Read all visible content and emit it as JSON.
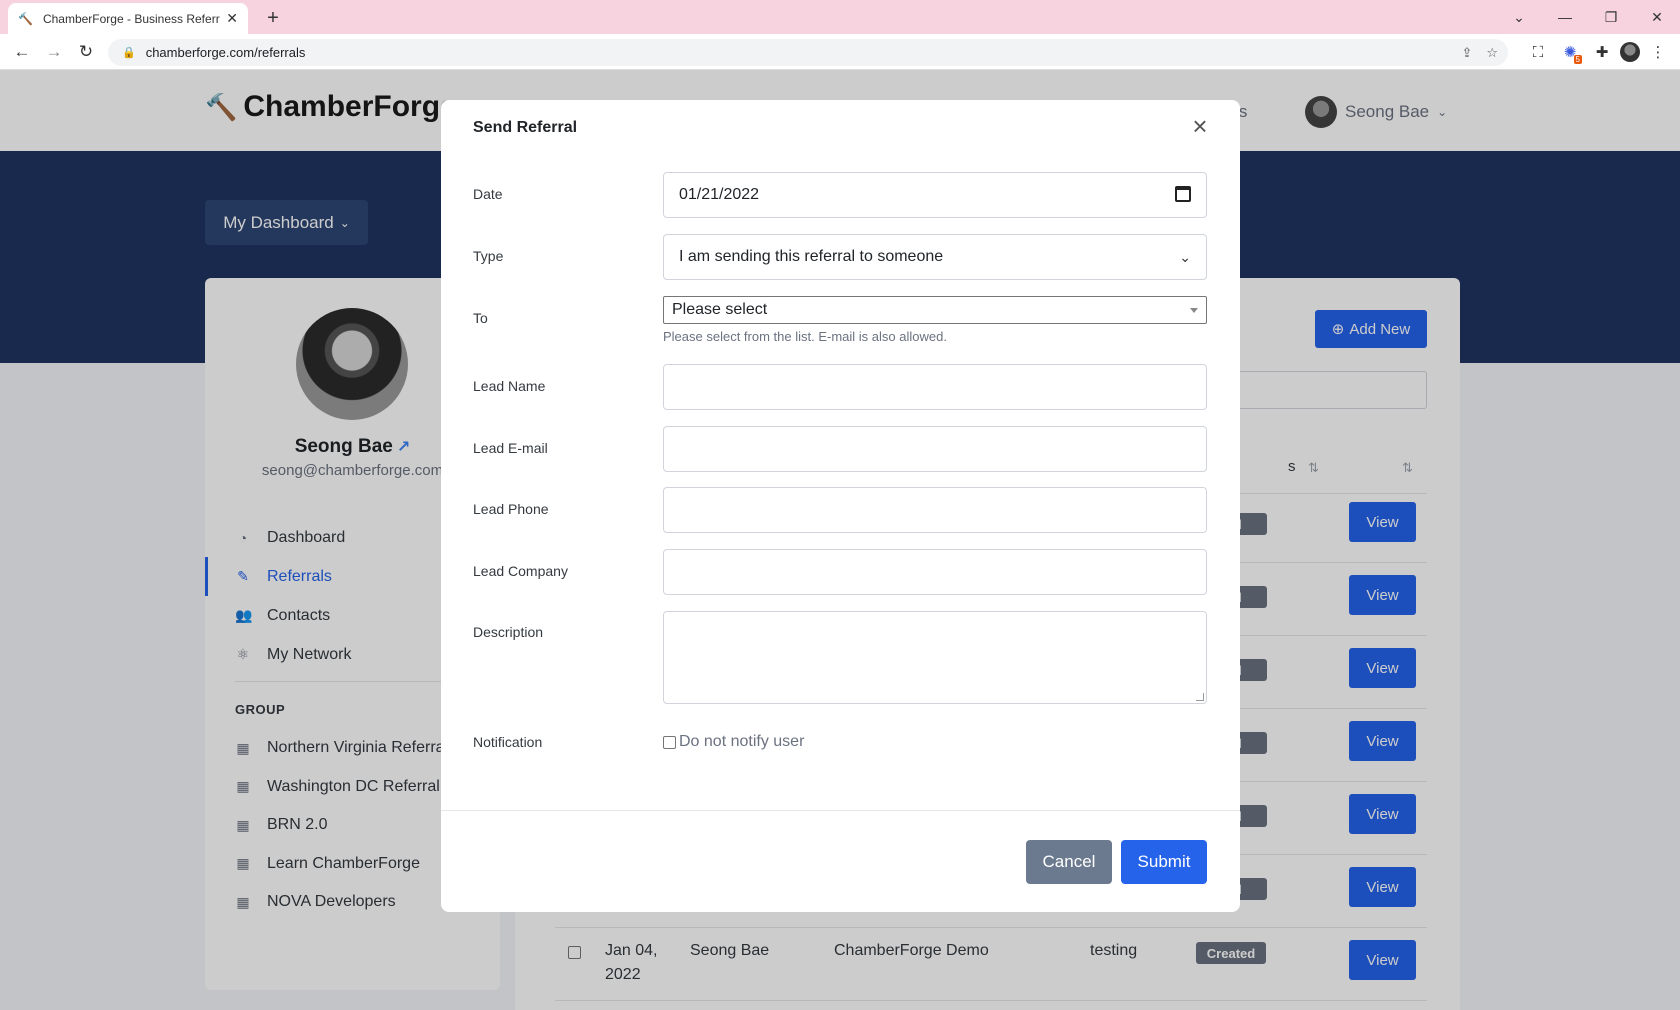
{
  "browser": {
    "tab_title": "ChamberForge - Business Referra",
    "url": "chamberforge.com/referrals",
    "extension_badge": "5"
  },
  "header": {
    "logo_text": "ChamberForge",
    "nav_groups_partial": "ups",
    "user_name": "Seong Bae"
  },
  "hero": {
    "dashboard_button": "My Dashboard"
  },
  "sidebar": {
    "profile_name": "Seong Bae",
    "profile_email": "seong@chamberforge.com",
    "items": [
      {
        "label": "Dashboard",
        "icon": "gauge-icon"
      },
      {
        "label": "Referrals",
        "icon": "pencil-icon",
        "active": true
      },
      {
        "label": "Contacts",
        "icon": "users-icon"
      },
      {
        "label": "My Network",
        "icon": "network-icon"
      }
    ],
    "group_label": "GROUP",
    "groups": [
      "Northern Virginia Referra",
      "Washington DC Referral",
      "BRN 2.0",
      "Learn ChamberForge",
      "NOVA Developers"
    ]
  },
  "main": {
    "add_new_label": "Add New",
    "status_header_partial": "s",
    "badge_partial": "ted",
    "view_label": "View",
    "last_row": {
      "date_line1": "Jan 04,",
      "date_line2": "2022",
      "from": "Seong Bae",
      "to": "ChamberForge Demo",
      "lead": "testing",
      "status": "Created",
      "action": "View"
    }
  },
  "modal": {
    "title": "Send Referral",
    "fields": {
      "date_label": "Date",
      "date_value": "01/21/2022",
      "type_label": "Type",
      "type_value": "I am sending this referral to someone",
      "to_label": "To",
      "to_value": "Please select",
      "to_help": "Please select from the list. E-mail is also allowed.",
      "lead_name_label": "Lead Name",
      "lead_email_label": "Lead E-mail",
      "lead_phone_label": "Lead Phone",
      "lead_company_label": "Lead Company",
      "description_label": "Description",
      "notification_label": "Notification",
      "notify_checkbox_label": "Do not notify user"
    },
    "cancel_label": "Cancel",
    "submit_label": "Submit"
  },
  "colors": {
    "primary": "#2563eb",
    "hero": "#1e3461",
    "badge": "#6b7280",
    "cancel": "#6b7a8f"
  }
}
